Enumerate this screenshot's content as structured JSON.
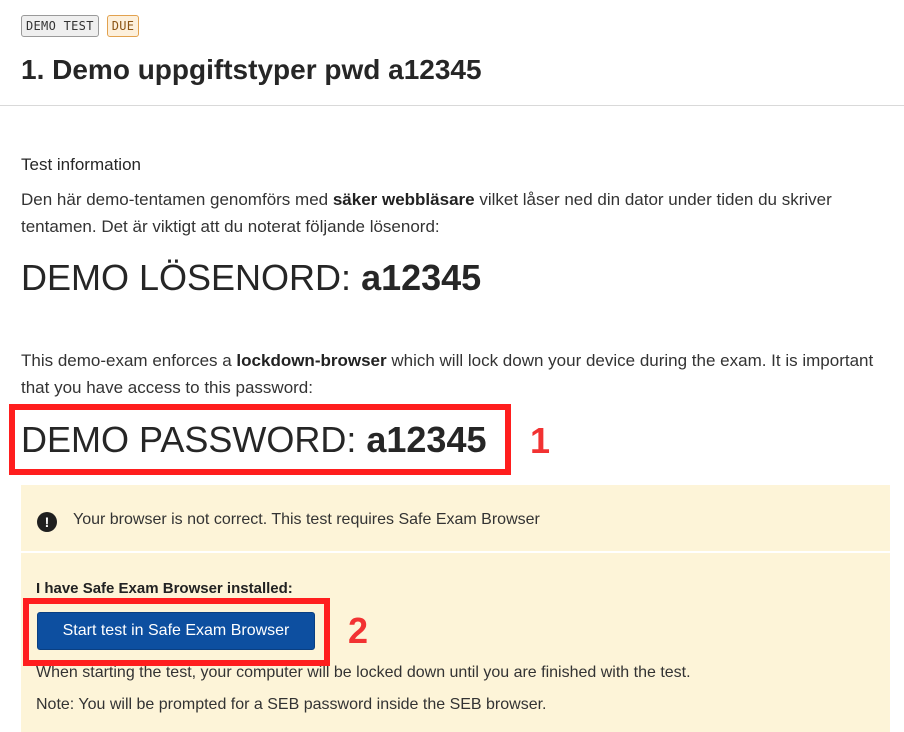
{
  "header": {
    "badges": [
      "DEMO TEST",
      "DUE"
    ],
    "title": "1. Demo uppgiftstyper pwd a12345"
  },
  "info": {
    "heading": "Test information",
    "sv_intro_pre": "Den här demo-tentamen genomförs med ",
    "sv_intro_bold": "säker webbläsare",
    "sv_intro_post": " vilket låser ned din dator under tiden du skriver tentamen. Det är viktigt att du noterat följande lösenord:",
    "sv_password_label": "DEMO LÖSENORD: ",
    "sv_password_value": "a12345",
    "en_intro_pre": "This demo-exam enforces a ",
    "en_intro_bold": "lockdown-browser",
    "en_intro_post": " which will lock down your device during the exam. It is important that you have access to this password:",
    "en_password_label": "DEMO PASSWORD: ",
    "en_password_value": "a12345"
  },
  "annotations": {
    "label_1": "1",
    "label_2": "2",
    "color": "#ff1e1e"
  },
  "warning": {
    "icon": "exclamation-circle-icon",
    "message": "Your browser is not correct. This test requires Safe Exam Browser",
    "installed_label": "I have Safe Exam Browser installed:",
    "button_label": "Start test in Safe Exam Browser",
    "note_1": "When starting the test, your computer will be locked down until you are finished with the test.",
    "note_2": "Note: You will be prompted for a SEB password inside the SEB browser."
  },
  "colors": {
    "button": "#0d4fa0",
    "warning_bg": "#fdf4d8",
    "due_badge": "#e2a24f"
  }
}
